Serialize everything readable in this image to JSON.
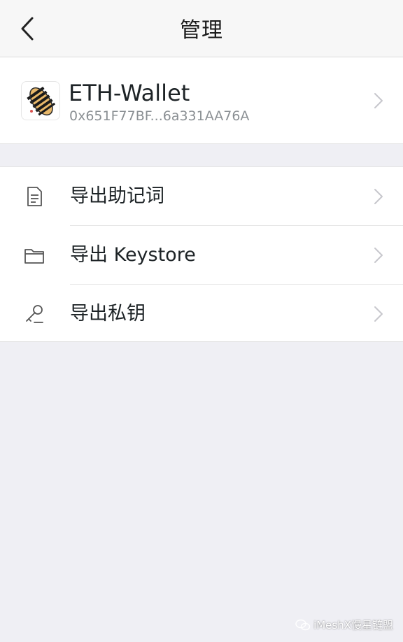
{
  "header": {
    "title": "管理",
    "back_icon": "chevron-left-icon"
  },
  "wallet": {
    "name": "ETH-Wallet",
    "address": "0x651F77BF...6a331AA76A",
    "avatar_icon": "wallet-avatar-icon"
  },
  "menu": {
    "items": [
      {
        "label": "导出助记词",
        "icon": "document-icon"
      },
      {
        "label": "导出 Keystore",
        "icon": "folder-icon"
      },
      {
        "label": "导出私钥",
        "icon": "key-icon"
      }
    ]
  },
  "watermark": {
    "text": "iMeshX慢星链盟"
  },
  "colors": {
    "background": "#efeff4",
    "card": "#ffffff",
    "text_primary": "#1d2326",
    "text_secondary": "#8a8f93",
    "chevron": "#c7c7cc"
  }
}
